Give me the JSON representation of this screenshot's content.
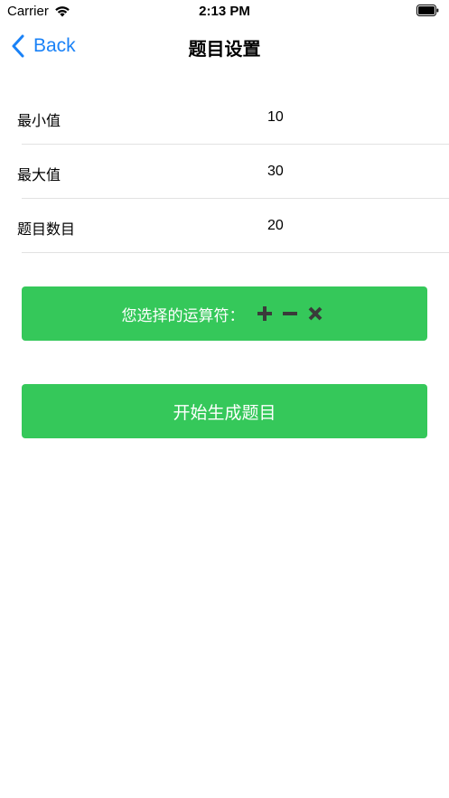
{
  "status_bar": {
    "carrier": "Carrier",
    "time": "2:13 PM"
  },
  "nav": {
    "back_label": "Back",
    "title": "题目设置"
  },
  "settings": [
    {
      "label": "最小值",
      "value": "10"
    },
    {
      "label": "最大值",
      "value": "30"
    },
    {
      "label": "题目数目",
      "value": "20"
    }
  ],
  "operator_button": {
    "label": "您选择的运算符：",
    "icons": [
      "plus-icon",
      "minus-icon",
      "multiply-icon"
    ]
  },
  "start_button": {
    "label": "开始生成题目"
  },
  "colors": {
    "accent_blue": "#1a82f7",
    "button_green": "#35c85a",
    "operator_icon": "#3a3a3a"
  }
}
